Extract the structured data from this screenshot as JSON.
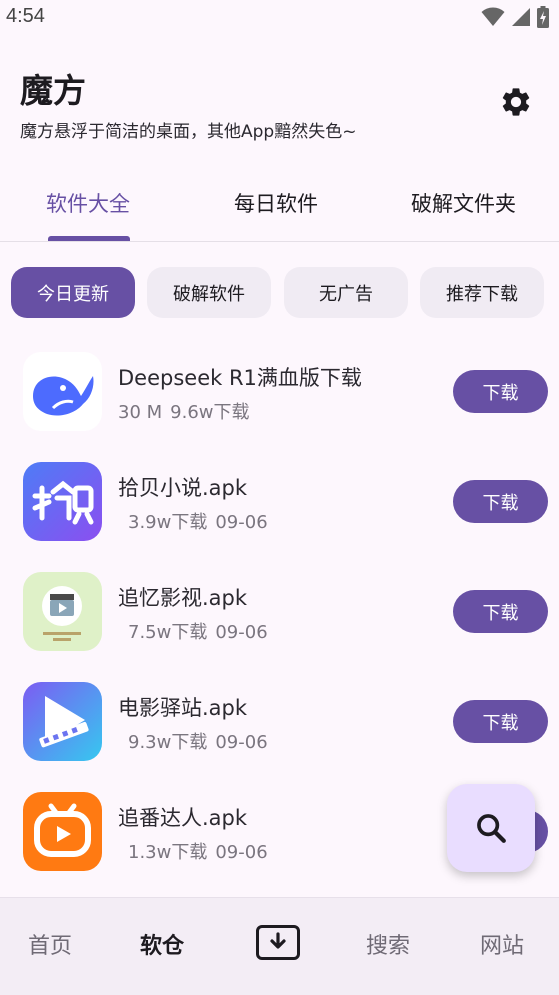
{
  "status_bar": {
    "time": "4:54",
    "icons": [
      "wifi-icon",
      "signal-icon",
      "battery-charging-icon"
    ]
  },
  "header": {
    "title": "魔方",
    "subtitle": "魔方悬浮于简洁的桌面，其他App黯然失色~",
    "settings_icon": "gear-icon"
  },
  "tabs": [
    {
      "label": "软件大全",
      "active": true
    },
    {
      "label": "每日软件",
      "active": false
    },
    {
      "label": "破解文件夹",
      "active": false
    }
  ],
  "chips": [
    {
      "label": "今日更新",
      "active": true
    },
    {
      "label": "破解软件",
      "active": false
    },
    {
      "label": "无广告",
      "active": false
    },
    {
      "label": "推荐下载",
      "active": false
    }
  ],
  "apps": [
    {
      "name": "Deepseek R1满血版下载",
      "size": "30 M",
      "downloads": "9.6w下载",
      "date": "",
      "button": "下载",
      "icon": "whale-icon"
    },
    {
      "name": "拾贝小说.apk",
      "size": "",
      "downloads": "3.9w下载",
      "date": "09-06",
      "button": "下载",
      "icon": "shibei-logo-icon"
    },
    {
      "name": "追忆影视.apk",
      "size": "",
      "downloads": "7.5w下载",
      "date": "09-06",
      "button": "下载",
      "icon": "film-clapper-icon"
    },
    {
      "name": "电影驿站.apk",
      "size": "",
      "downloads": "9.3w下载",
      "date": "09-06",
      "button": "下载",
      "icon": "play-film-icon"
    },
    {
      "name": "追番达人.apk",
      "size": "",
      "downloads": "1.3w下载",
      "date": "09-06",
      "button": "下载",
      "icon": "tv-play-icon"
    }
  ],
  "fab": {
    "icon": "search-icon"
  },
  "bottom_nav": [
    {
      "label": "首页",
      "active": false
    },
    {
      "label": "软仓",
      "active": true
    },
    {
      "label": "",
      "icon": "download-box-icon"
    },
    {
      "label": "搜索",
      "active": false
    },
    {
      "label": "网站",
      "active": false
    }
  ],
  "colors": {
    "primary": "#6750a4",
    "chip_bg": "#f0ebf3",
    "fab_bg": "#e9ddff",
    "page_bg": "#fdf7fd"
  }
}
